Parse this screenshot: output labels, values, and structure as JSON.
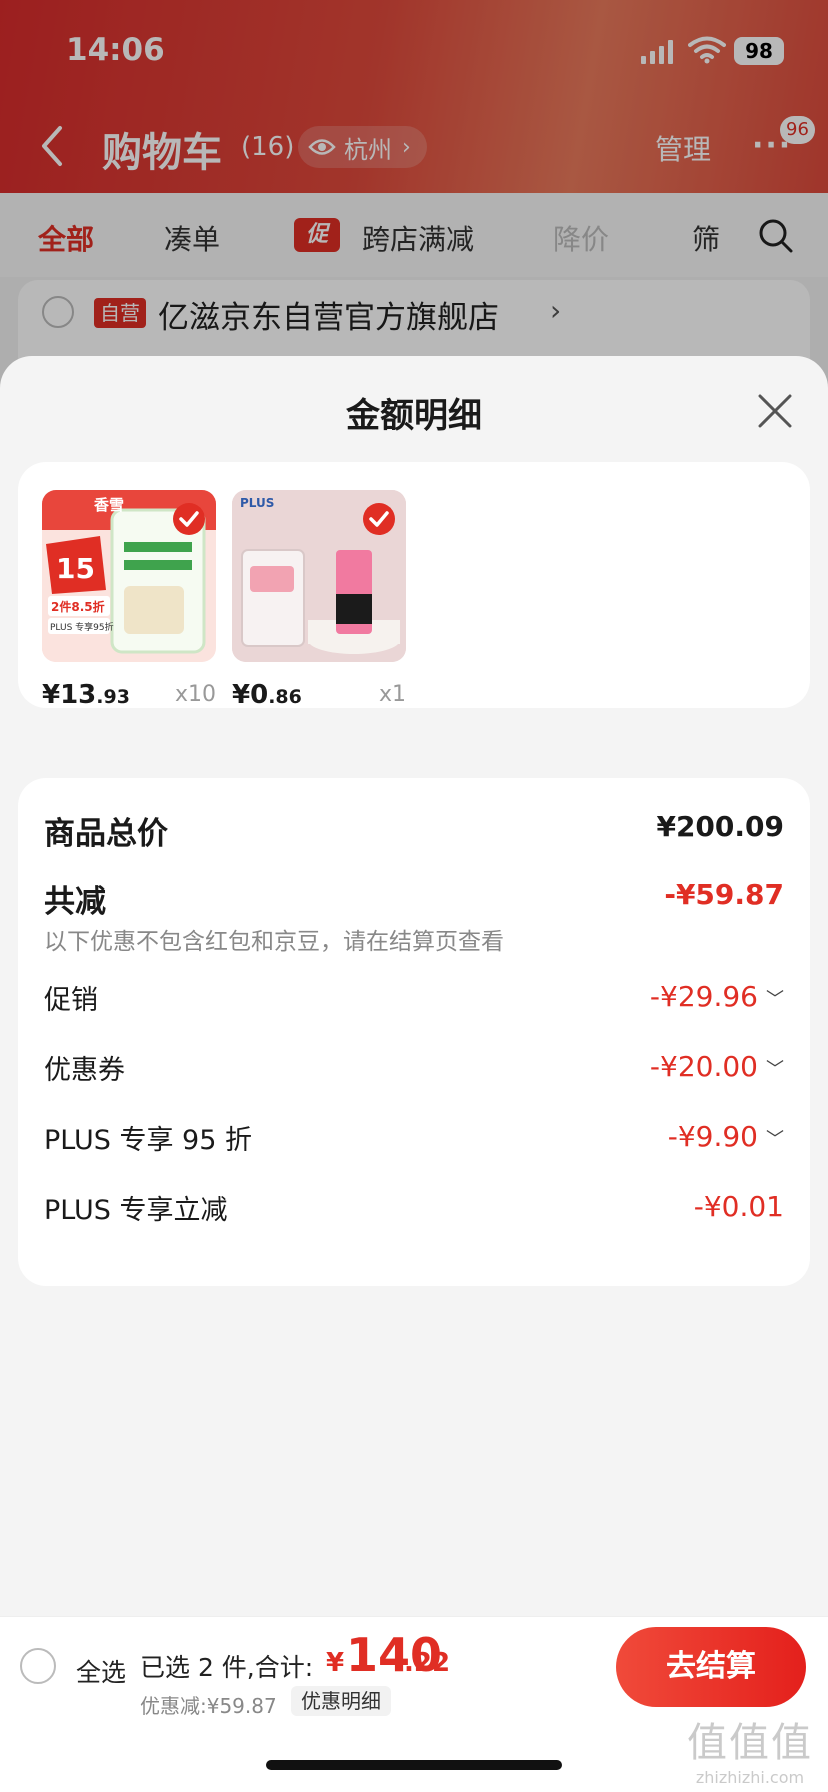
{
  "status_bar": {
    "time": "14:06",
    "battery": "98"
  },
  "header": {
    "title": "购物车",
    "count": "(16)",
    "location": "杭州",
    "manage": "管理",
    "message_badge": "96"
  },
  "tabs": [
    {
      "label": "全部",
      "active": true
    },
    {
      "label": "凑单"
    },
    {
      "label": "促",
      "tag": true
    },
    {
      "label": "跨店满减"
    },
    {
      "label": "降价"
    },
    {
      "label": "筛"
    }
  ],
  "store": {
    "tag": "自营",
    "name": "亿滋京东自营官方旗舰店"
  },
  "sheet": {
    "title": "金额明细",
    "products": [
      {
        "price_yen": "¥",
        "price_int": "13",
        "price_dec": ".93",
        "qty": "x10",
        "thumb_text_1": "香雪",
        "thumb_text_2": "15",
        "thumb_text_3": "2件8.5折",
        "thumb_text_4": "PLUS 专享95折"
      },
      {
        "price_yen": "¥",
        "price_int": "0",
        "price_dec": ".86",
        "qty": "x1",
        "thumb_text_1": "PLUS"
      }
    ],
    "summary": {
      "total_label": "商品总价",
      "total_value": "¥200.09",
      "discount_label": "共减",
      "discount_value": "-¥59.87",
      "discount_note": "以下优惠不包含红包和京豆，请在结算页查看",
      "items": [
        {
          "label": "促销",
          "value": "-¥29.96",
          "expandable": true
        },
        {
          "label": "优惠券",
          "value": "-¥20.00",
          "expandable": true
        },
        {
          "label": "PLUS 专享 95 折",
          "value": "-¥9.90",
          "expandable": true
        },
        {
          "label": "PLUS 专享立减",
          "value": "-¥0.01",
          "expandable": false
        }
      ]
    }
  },
  "bottom_bar": {
    "select_all": "全选",
    "selected": "已选 2 件,合计:",
    "total_yen": "¥",
    "total_int": "140",
    "total_dec": ".22",
    "discount": "优惠减:¥59.87",
    "detail_link": "优惠明细",
    "checkout": "去结算"
  },
  "watermark": {
    "glyph": "值值值",
    "url": "zhizhizhi.com"
  },
  "colors": {
    "accent": "#e02e24",
    "sheet_bg": "#f4f4f4"
  }
}
